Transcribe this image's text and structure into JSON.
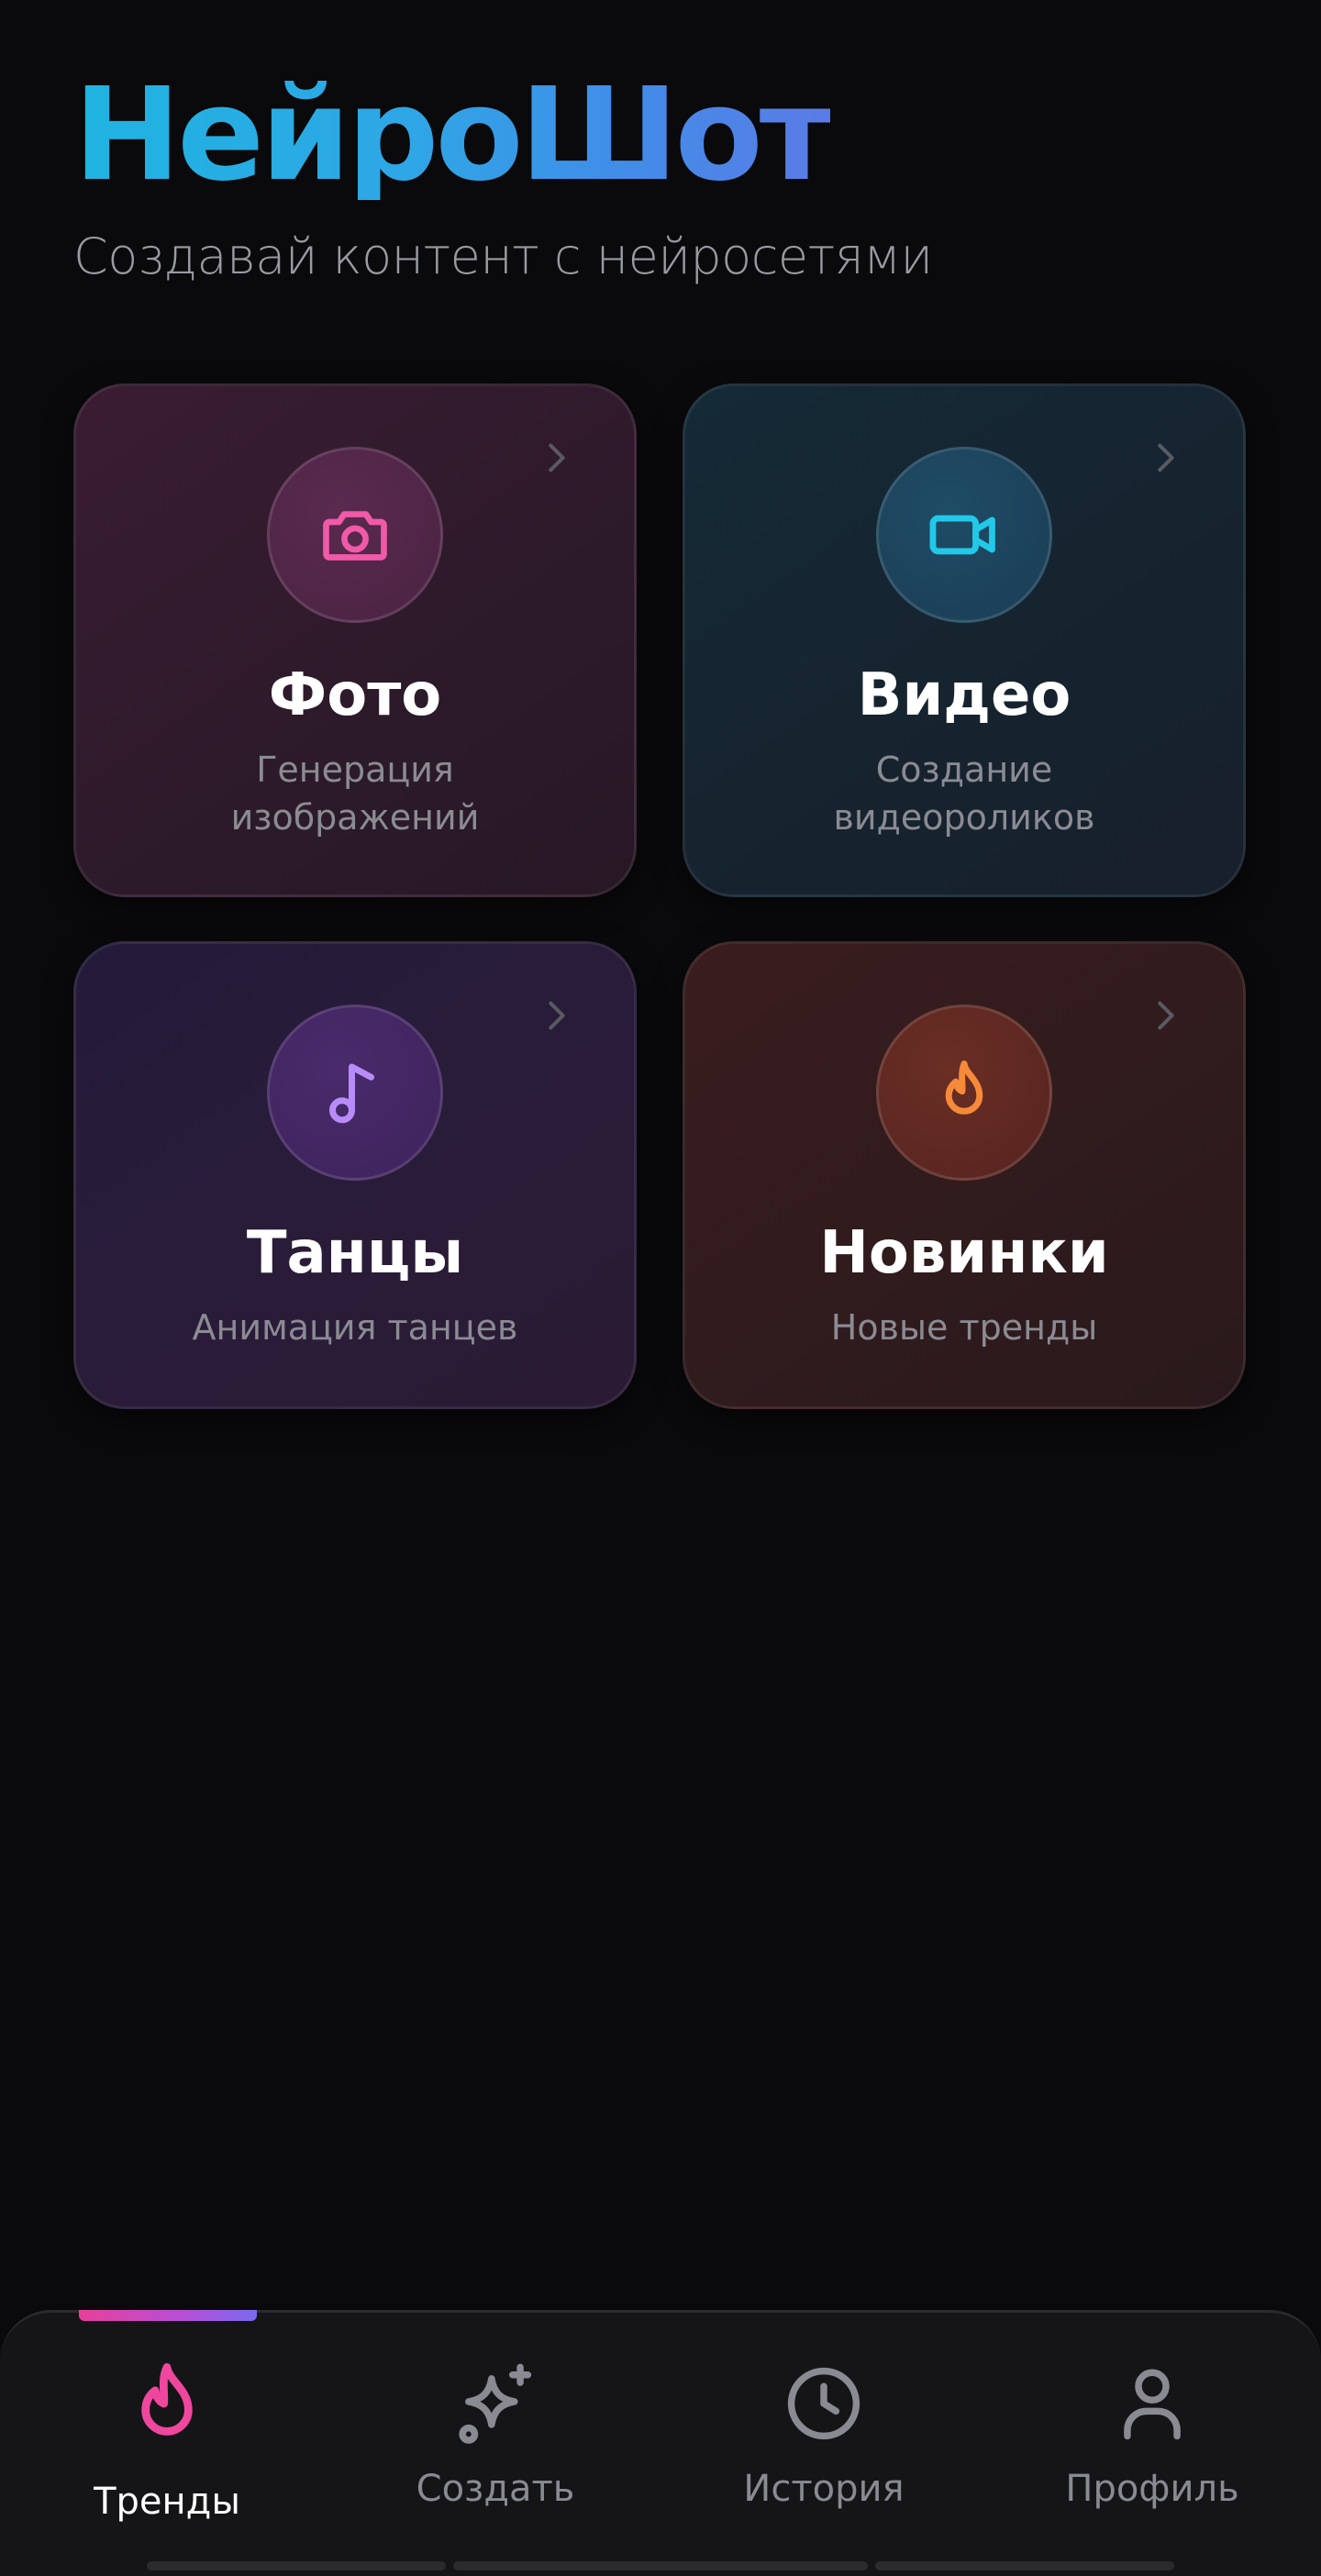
{
  "header": {
    "brand": "НейроШот",
    "tagline": "Создавай контент с нейросетями"
  },
  "cards": [
    {
      "id": "photo",
      "title": "Фото",
      "subtitle": "Генерация изображений",
      "icon": "camera-icon",
      "accent": "#f05aa8"
    },
    {
      "id": "video",
      "title": "Видео",
      "subtitle": "Создание видеороликов",
      "icon": "video-camera-icon",
      "accent": "#22c8e8"
    },
    {
      "id": "dance",
      "title": "Танцы",
      "subtitle": "Анимация танцев",
      "icon": "music-note-icon",
      "accent": "#b88cf8"
    },
    {
      "id": "news",
      "title": "Новинки",
      "subtitle": "Новые тренды",
      "icon": "flame-icon",
      "accent": "#f58a3a"
    }
  ],
  "tabbar": {
    "active": "trends",
    "tabs": [
      {
        "id": "trends",
        "label": "Тренды",
        "icon": "flame-icon",
        "color": "#f0479e"
      },
      {
        "id": "create",
        "label": "Создать",
        "icon": "sparkle-icon",
        "color": "#8a8a92"
      },
      {
        "id": "history",
        "label": "История",
        "icon": "clock-icon",
        "color": "#8a8a92"
      },
      {
        "id": "profile",
        "label": "Профиль",
        "icon": "user-icon",
        "color": "#8a8a92"
      }
    ]
  },
  "colors": {
    "background": "#0a0a0c",
    "brand_gradient_start": "#1fb4e0",
    "brand_gradient_end": "#5a7be6",
    "active_tab": "#f0479e"
  }
}
